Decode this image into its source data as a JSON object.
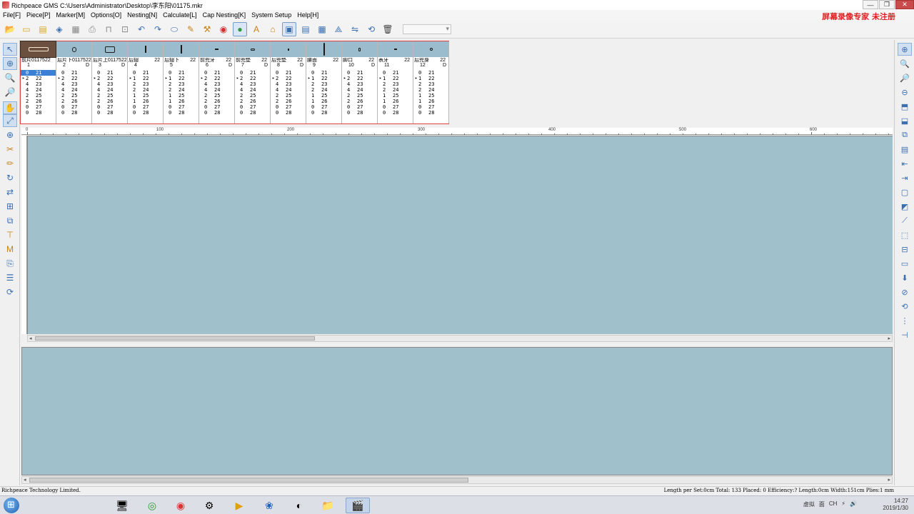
{
  "window": {
    "title": "Richpeace GMS C:\\Users\\Administrator\\Desktop\\李东阳\\01175.mkr",
    "min_label": "—",
    "max_label": "❐",
    "close_label": "✕"
  },
  "menu": {
    "items": [
      "File[F]",
      "Piece[P]",
      "Marker[M]",
      "Options[O]",
      "Nesting[N]",
      "Calculate[L]",
      "Cap Nesting[K]",
      "System Setup",
      "Help[H]"
    ],
    "watermark": "屏幕录像专家  未注册"
  },
  "toolbar": {
    "icons": [
      "open-folder-icon",
      "new-file-icon",
      "open-file-icon",
      "save-icon",
      "save-as-icon",
      "print-icon",
      "plot-icon",
      "zoom-icon",
      "undo-icon",
      "redo-icon",
      "layout-icon",
      "piece-tool-icon",
      "nesting-tool-icon",
      "color-wheel-icon",
      "auto-nest-icon",
      "text-icon",
      "stamp-icon",
      "grid-view-icon",
      "list-view-icon",
      "table-icon",
      "measure-icon",
      "flip-icon",
      "rotate-icon",
      "delete-icon"
    ],
    "combo_value": ""
  },
  "pieces": [
    {
      "name": "前片0117522",
      "qty": "",
      "num": "1",
      "flag": "",
      "selected": true
    },
    {
      "name": "后片下0117522",
      "qty": "",
      "num": "2",
      "flag": "D",
      "selected": false
    },
    {
      "name": "后片上0117522",
      "qty": "",
      "num": "3",
      "flag": "D",
      "selected": false
    },
    {
      "name": "后翅",
      "qty": "22",
      "num": "4",
      "flag": "",
      "selected": false
    },
    {
      "name": "后翅下",
      "qty": "22",
      "num": "5",
      "flag": "",
      "selected": false
    },
    {
      "name": "前兜牙",
      "qty": "22",
      "num": "6",
      "flag": "D",
      "selected": false
    },
    {
      "name": "前兜垫",
      "qty": "22",
      "num": "7",
      "flag": "D",
      "selected": false
    },
    {
      "name": "后兜垫",
      "qty": "22",
      "num": "8",
      "flag": "D",
      "selected": false
    },
    {
      "name": "腰面",
      "qty": "22",
      "num": "9",
      "flag": "",
      "selected": false
    },
    {
      "name": "脚口",
      "qty": "22",
      "num": "10",
      "flag": "D",
      "selected": false
    },
    {
      "name": "表牙",
      "qty": "22",
      "num": "11",
      "flag": "",
      "selected": false
    },
    {
      "name": "后兜身",
      "qty": "22",
      "num": "12",
      "flag": "D",
      "selected": false
    }
  ],
  "size_rows_a": [
    [
      "0",
      "21"
    ],
    [
      "2",
      "22"
    ],
    [
      "4",
      "23"
    ],
    [
      "4",
      "24"
    ],
    [
      "2",
      "25"
    ],
    [
      "2",
      "26"
    ],
    [
      "0",
      "27"
    ],
    [
      "0",
      "28"
    ]
  ],
  "size_rows_b": [
    [
      "0",
      "21"
    ],
    [
      "1",
      "22"
    ],
    [
      "2",
      "23"
    ],
    [
      "2",
      "24"
    ],
    [
      "1",
      "25"
    ],
    [
      "1",
      "26"
    ],
    [
      "0",
      "27"
    ],
    [
      "0",
      "28"
    ]
  ],
  "ruler": {
    "labels": [
      "0",
      "100",
      "200",
      "300",
      "400",
      "500",
      "600"
    ]
  },
  "status": {
    "left": "Richpeace Technology Limited.",
    "right": "Length per Set:0cm  Total: 133  Placed: 0  Efficiency:?  Length:0cm  Width:151cm  Plies:1  mm"
  },
  "taskbar": {
    "tray": [
      "虚拟",
      "面",
      "CH",
      "⚡",
      "🔊"
    ],
    "time": "14:27",
    "date": "2019/1/30"
  }
}
